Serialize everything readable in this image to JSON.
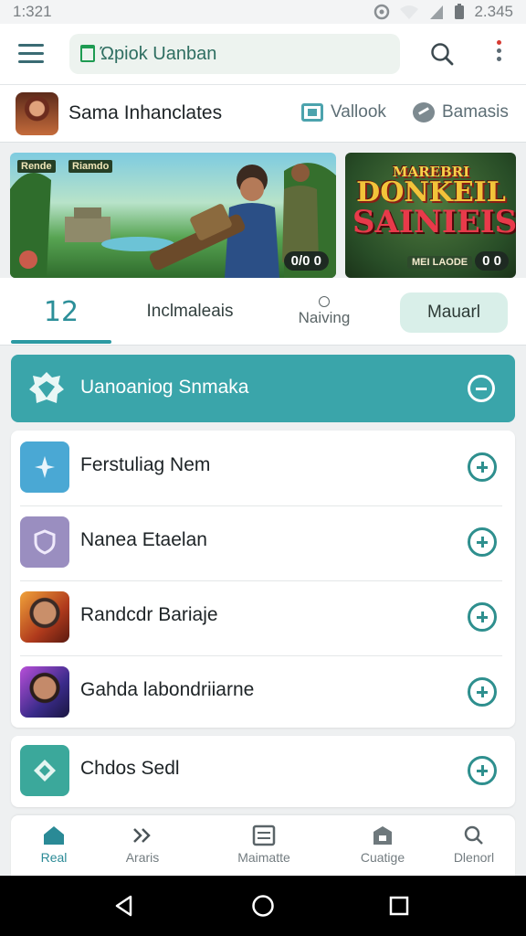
{
  "status_bar": {
    "time": "1:321",
    "battery": "2.345"
  },
  "app_bar": {
    "search_text": "Ώpiok Uanban"
  },
  "app_row": {
    "app_name": "Sama Inhanclates",
    "link_1": "Vallook",
    "link_2": "Bamasis"
  },
  "banners": [
    {
      "tag_1": "Rende",
      "tag_2": "Riamdo",
      "pill": "0/0 0"
    },
    {
      "logo_small": "MAREBRI",
      "logo_line1": "DONKEIL",
      "logo_line2": "SAINIEIS",
      "sub_pill": "MEI LAODE",
      "pill": "0 0"
    }
  ],
  "tabs": [
    {
      "label": "12"
    },
    {
      "label": "Inclmaleais"
    },
    {
      "label": "Naiving"
    },
    {
      "label": "Mauarl"
    }
  ],
  "section": {
    "title": "Uanoaniog Snmaka"
  },
  "list_items": [
    {
      "label": "Ferstuliag Nem",
      "thumb": "thumb-blue"
    },
    {
      "label": "Nanea Etaelan",
      "thumb": "thumb-purple"
    },
    {
      "label": "Randcdr Bariaje",
      "thumb": "thumb-game1"
    },
    {
      "label": "Gahda labondriiarne",
      "thumb": "thumb-game2"
    }
  ],
  "single_item": {
    "label": "Chdos Sedl"
  },
  "bottom_nav": [
    {
      "label": "Real",
      "icon": "home-icon",
      "active": true
    },
    {
      "label": "Araris",
      "icon": "chevrons-icon",
      "active": false
    },
    {
      "label": "Maimatte",
      "icon": "grid-card-icon",
      "active": false
    },
    {
      "label": "Cuatige",
      "icon": "store-icon",
      "active": false
    },
    {
      "label": "Dlenorl",
      "icon": "search-icon",
      "active": false
    }
  ],
  "colors": {
    "accent": "#3aa5aa",
    "accent_dark": "#2e8f8e",
    "tab_active": "#d9efe9"
  }
}
